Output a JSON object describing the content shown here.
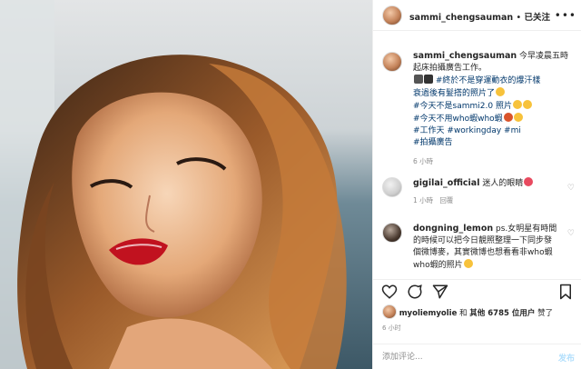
{
  "post": {
    "username": "sammi_chengsauman",
    "follow_label": "已关注",
    "separator": "•",
    "caption_text": "今早凌晨五時起床拍攝廣告工作。",
    "caption_line2": "#終於不是穿運動衣的爆汗樣",
    "caption_line3": "衰過後有髮搭的照片了",
    "hashtags": [
      "#今天不是sammi2.0 照片",
      "#今天不用who蝦who蝦",
      "#工作天 #workingday #mi",
      "#拍攝廣告"
    ],
    "caption_time": "6 小時"
  },
  "comments": [
    {
      "username": "gigilai_official",
      "text": "迷人的眼睛",
      "time": "1 小時",
      "reply_label": "回覆"
    },
    {
      "username": "dongning_lemon",
      "text": "ps.女明星有時間的時候可以把今日靚照整理一下同步發個微博麥，其實微博也想看看非who蝦who蝦的照片"
    }
  ],
  "likes": {
    "liker": "myoliemyolie",
    "and_label": "和",
    "others_label": "其他 6785 位用户",
    "suffix": "赞了"
  },
  "post_time": "6 小时",
  "composer": {
    "placeholder": "添加评论...",
    "post_label": "发布"
  },
  "colors": {
    "hashtag": "#00376b",
    "post_button_disabled": "#b2dffc",
    "text": "#262626",
    "meta": "#8e8e8e"
  },
  "icons": [
    "heart-icon",
    "comment-icon",
    "share-icon",
    "bookmark-icon",
    "more-icon"
  ]
}
